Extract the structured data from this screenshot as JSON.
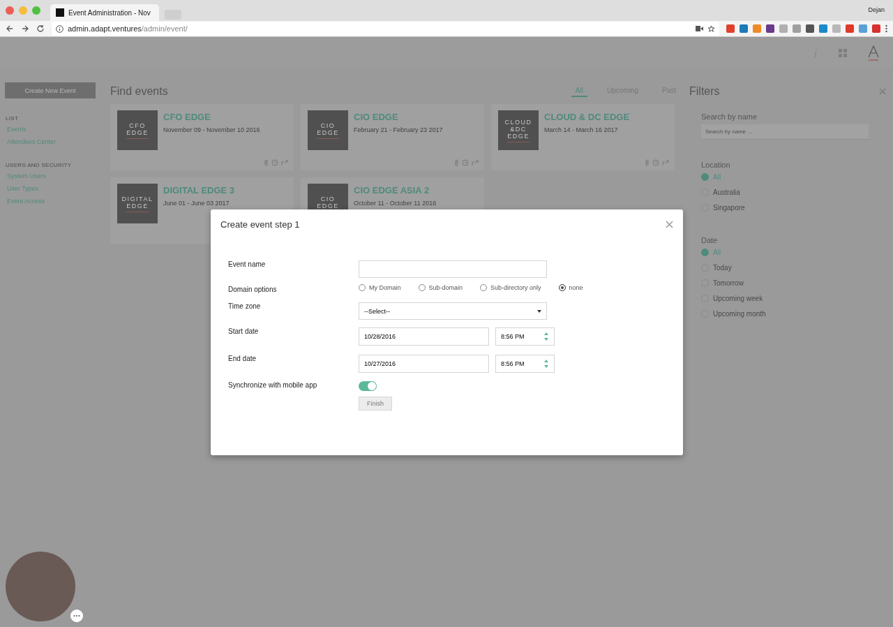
{
  "browser": {
    "tab_title": "Event Administration - Nov",
    "user": "Dejan",
    "url_host": "admin.adapt.ventures",
    "url_path": "/admin/event/"
  },
  "sidebar": {
    "create_button": "Create New Event",
    "sections": [
      {
        "heading": "LIST",
        "items": [
          "Events",
          "Attendees Center"
        ]
      },
      {
        "heading": "USERS AND SECURITY",
        "items": [
          "System Users",
          "User Types",
          "Event Access"
        ]
      }
    ]
  },
  "main": {
    "title": "Find events",
    "tabs": [
      {
        "label": "All",
        "selected": true
      },
      {
        "label": "Upcoming",
        "selected": false
      },
      {
        "label": "Past",
        "selected": false
      }
    ],
    "events": [
      {
        "thumb_lines": [
          "CFO",
          "EDGE"
        ],
        "name": "CFO EDGE",
        "dates": "November 09 - November 10 2016"
      },
      {
        "thumb_lines": [
          "CIO",
          "EDGE"
        ],
        "name": "CIO EDGE",
        "dates": "February 21 - February 23 2017"
      },
      {
        "thumb_lines": [
          "CLOUD",
          "&DC",
          "EDGE"
        ],
        "name": "CLOUD & DC EDGE",
        "dates": "March 14 - March 16 2017"
      },
      {
        "thumb_lines": [
          "DIGITAL",
          "EDGE"
        ],
        "name": "DIGITAL EDGE 3",
        "dates": "June 01 - June 03 2017"
      },
      {
        "thumb_lines": [
          "CIO",
          "EDGE"
        ],
        "name": "CIO EDGE ASIA 2",
        "dates": "October 11 - October 11 2016"
      }
    ]
  },
  "filters": {
    "title": "Filters",
    "search_label": "Search by name",
    "search_placeholder": "Search by name ...",
    "groups": [
      {
        "label": "Location",
        "options": [
          {
            "label": "All",
            "selected": true
          },
          {
            "label": "Australia",
            "selected": false
          },
          {
            "label": "Singapore",
            "selected": false
          }
        ]
      },
      {
        "label": "Date",
        "options": [
          {
            "label": "All",
            "selected": true
          },
          {
            "label": "Today",
            "selected": false
          },
          {
            "label": "Tomorrow",
            "selected": false
          },
          {
            "label": "Upcoming week",
            "selected": false
          },
          {
            "label": "Upcoming month",
            "selected": false
          }
        ]
      }
    ]
  },
  "modal": {
    "title": "Create event step 1",
    "event_name_label": "Event name",
    "domain": {
      "label": "Domain options",
      "options": [
        {
          "label": "My Domain",
          "selected": false
        },
        {
          "label": "Sub-domain",
          "selected": false
        },
        {
          "label": "Sub-directory only",
          "selected": false
        },
        {
          "label": "none",
          "selected": true
        }
      ]
    },
    "time_zone": {
      "label": "Time zone",
      "value": "--Select--"
    },
    "start": {
      "label": "Start date",
      "date": "10/28/2016",
      "time": "8:56 PM"
    },
    "end": {
      "label": "End date",
      "date": "10/27/2016",
      "time": "8:56 PM"
    },
    "sync": {
      "label": "Synchronize with mobile app",
      "on": true
    },
    "finish": "Finish"
  }
}
